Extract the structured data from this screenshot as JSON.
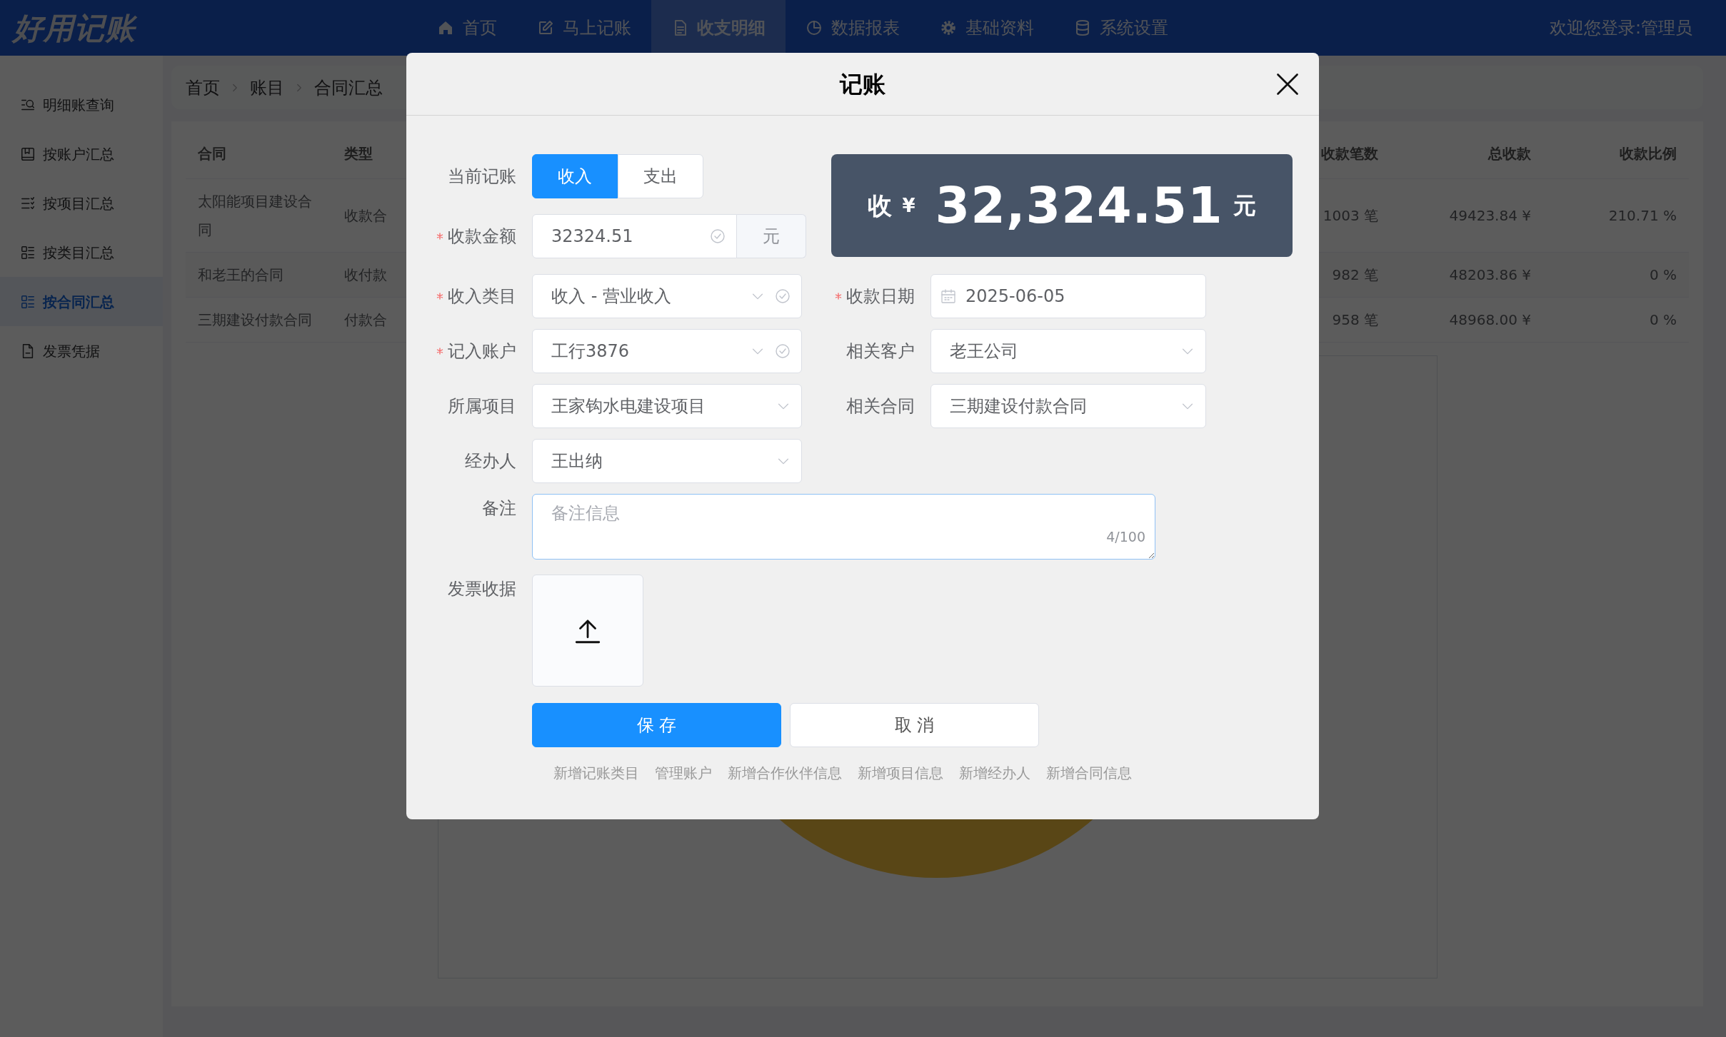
{
  "navbar": {
    "logo": "好用记账",
    "items": [
      {
        "label": "首页",
        "selected": false
      },
      {
        "label": "马上记账",
        "selected": false
      },
      {
        "label": "收支明细",
        "selected": true
      },
      {
        "label": "数据报表",
        "selected": false
      },
      {
        "label": "基础资料",
        "selected": false
      },
      {
        "label": "系统设置",
        "selected": false
      }
    ],
    "user": "欢迎您登录:管理员"
  },
  "sidebar": {
    "items": [
      {
        "label": "明细账查询",
        "selected": false
      },
      {
        "label": "按账户汇总",
        "selected": false
      },
      {
        "label": "按项目汇总",
        "selected": false
      },
      {
        "label": "按类目汇总",
        "selected": false
      },
      {
        "label": "按合同汇总",
        "selected": true
      },
      {
        "label": "发票凭据",
        "selected": false
      }
    ]
  },
  "breadcrumb": [
    "首页",
    "账目",
    "合同汇总"
  ],
  "table": {
    "columns": [
      "合同",
      "类型",
      "收款笔数",
      "总收款",
      "收款比例"
    ],
    "rows": [
      {
        "cells": [
          "太阳能项目建设合同",
          "收款合",
          "1003 笔",
          "49423.84 ¥",
          "210.71 %"
        ]
      },
      {
        "cells": [
          "和老王的合同",
          "收付款",
          "982 笔",
          "48203.86 ¥",
          "0 %"
        ]
      },
      {
        "cells": [
          "三期建设付款合同",
          "付款合",
          "958 笔",
          "48968.00 ¥",
          "0 %"
        ]
      }
    ]
  },
  "dialog": {
    "title": "记账",
    "mode": {
      "label": "当前记账",
      "options": [
        {
          "label": "收入",
          "selected": true
        },
        {
          "label": "支出",
          "selected": false
        }
      ]
    },
    "amount": {
      "label": "收款金额",
      "required": true,
      "value": "32324.51",
      "valid": true,
      "unit": "元"
    },
    "summary": {
      "type": "收",
      "currency": "¥",
      "value": "32,324.51",
      "unit": "元"
    },
    "field_rows": [
      [
        {
          "label": "收入类目",
          "required": true,
          "kind": "select",
          "value": "收入 - 营业收入",
          "valid": true
        },
        {
          "label": "收款日期",
          "required": true,
          "kind": "date",
          "value": "2025-06-05",
          "valid": false
        }
      ],
      [
        {
          "label": "记入账户",
          "required": true,
          "kind": "select",
          "value": "工行3876",
          "valid": true
        },
        {
          "label": "相关客户",
          "required": false,
          "kind": "select",
          "value": "老王公司",
          "valid": false
        }
      ],
      [
        {
          "label": "所属项目",
          "required": false,
          "kind": "select",
          "value": "王家钩水电建设项目",
          "valid": false
        },
        {
          "label": "相关合同",
          "required": false,
          "kind": "select",
          "value": "三期建设付款合同",
          "valid": false
        }
      ],
      [
        {
          "label": "经办人",
          "required": false,
          "kind": "select",
          "value": "王出纳",
          "valid": false
        }
      ]
    ],
    "remark": {
      "label": "备注",
      "placeholder": "备注信息",
      "counter": "4/100"
    },
    "attachment": {
      "label": "发票收据"
    },
    "buttons": [
      {
        "label": "保 存",
        "kind": "primary"
      },
      {
        "label": "取 消",
        "kind": "default"
      }
    ],
    "links": [
      "新增记账类目",
      "管理账户",
      "新增合作伙伴信息",
      "新增项目信息",
      "新增经办人",
      "新增合同信息"
    ]
  }
}
